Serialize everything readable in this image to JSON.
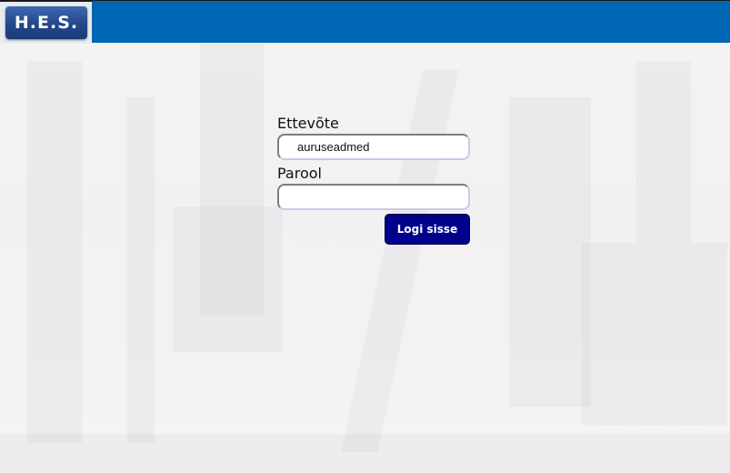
{
  "header": {
    "logo_text": "H.E.S.",
    "bar_color": "#0067b4"
  },
  "login": {
    "company_label": "Ettevõte",
    "company_value": "auruseadmed",
    "password_label": "Parool",
    "password_value": "",
    "submit_label": "Logi sisse",
    "submit_color": "#00008b"
  }
}
